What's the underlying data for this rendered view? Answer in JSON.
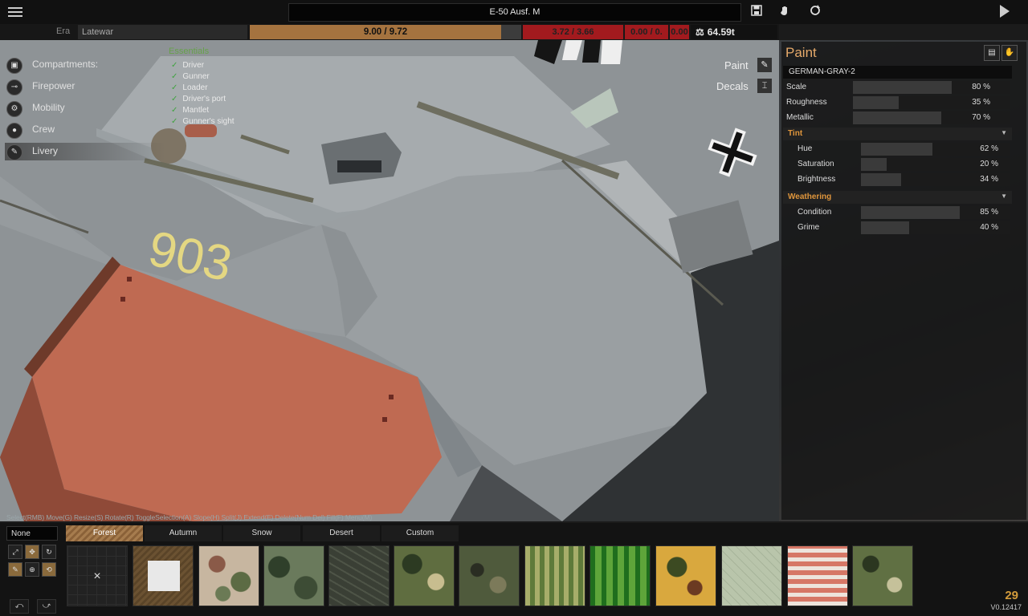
{
  "topbar": {
    "vehicle_name": "E-50 Ausf. M",
    "icons": [
      "menu-icon",
      "save-icon",
      "hand-icon",
      "refresh-icon",
      "play-icon"
    ]
  },
  "stats": {
    "era_label": "Era",
    "era_value": "Latewar",
    "weight_text": "9.00 / 9.72",
    "weight_fill_fraction": 0.926,
    "red_a": "3.72 / 3.66",
    "red_b": "0.00 / 0.",
    "red_c": "0.00",
    "tonnage": "64.59t",
    "colors": {
      "weight": "#a5733f",
      "warning": "#a21a1e"
    }
  },
  "nav": {
    "items": [
      {
        "label": "Compartments:",
        "icon": "box-icon"
      },
      {
        "label": "Firepower",
        "icon": "cannon-icon"
      },
      {
        "label": "Mobility",
        "icon": "gear-icon"
      },
      {
        "label": "Crew",
        "icon": "person-icon"
      },
      {
        "label": "Livery",
        "icon": "brush-icon"
      }
    ]
  },
  "essentials": {
    "title": "Essentials",
    "items": [
      "Driver",
      "Gunner",
      "Loader",
      "Driver's port",
      "Mantlet",
      "Gunner's sight"
    ]
  },
  "viewport": {
    "paint_label": "Paint",
    "decals_label": "Decals",
    "hull_number": "903",
    "hints": "Select(RMB) Move(G) Resize(S) Rotate(R) ToggleSelection(A) Slope(H) Split(J) Extend(E) Delete(Num Del) Fill(F) Menu(M)"
  },
  "paint_panel": {
    "title": "Paint",
    "paint_name": "GERMAN-GRAY-2",
    "sliders": [
      {
        "label": "Scale",
        "value": "80 %",
        "fraction": 0.8
      },
      {
        "label": "Roughness",
        "value": "35 %",
        "fraction": 0.35
      },
      {
        "label": "Metallic",
        "value": "70 %",
        "fraction": 0.7
      }
    ],
    "tint": {
      "title": "Tint",
      "sliders": [
        {
          "label": "Hue",
          "value": "62 %",
          "fraction": 0.62
        },
        {
          "label": "Saturation",
          "value": "20 %",
          "fraction": 0.2
        },
        {
          "label": "Brightness",
          "value": "34 %",
          "fraction": 0.34
        }
      ]
    },
    "weathering": {
      "title": "Weathering",
      "sliders": [
        {
          "label": "Condition",
          "value": "85 %",
          "fraction": 0.85
        },
        {
          "label": "Grime",
          "value": "40 %",
          "fraction": 0.4
        }
      ]
    }
  },
  "bottom": {
    "none_label": "None",
    "tabs": [
      "Forest",
      "Autumn",
      "Snow",
      "Desert",
      "Custom"
    ],
    "active_tab": "Forest",
    "none_swatch": "×",
    "counter": "29",
    "version": "V0.12417"
  }
}
